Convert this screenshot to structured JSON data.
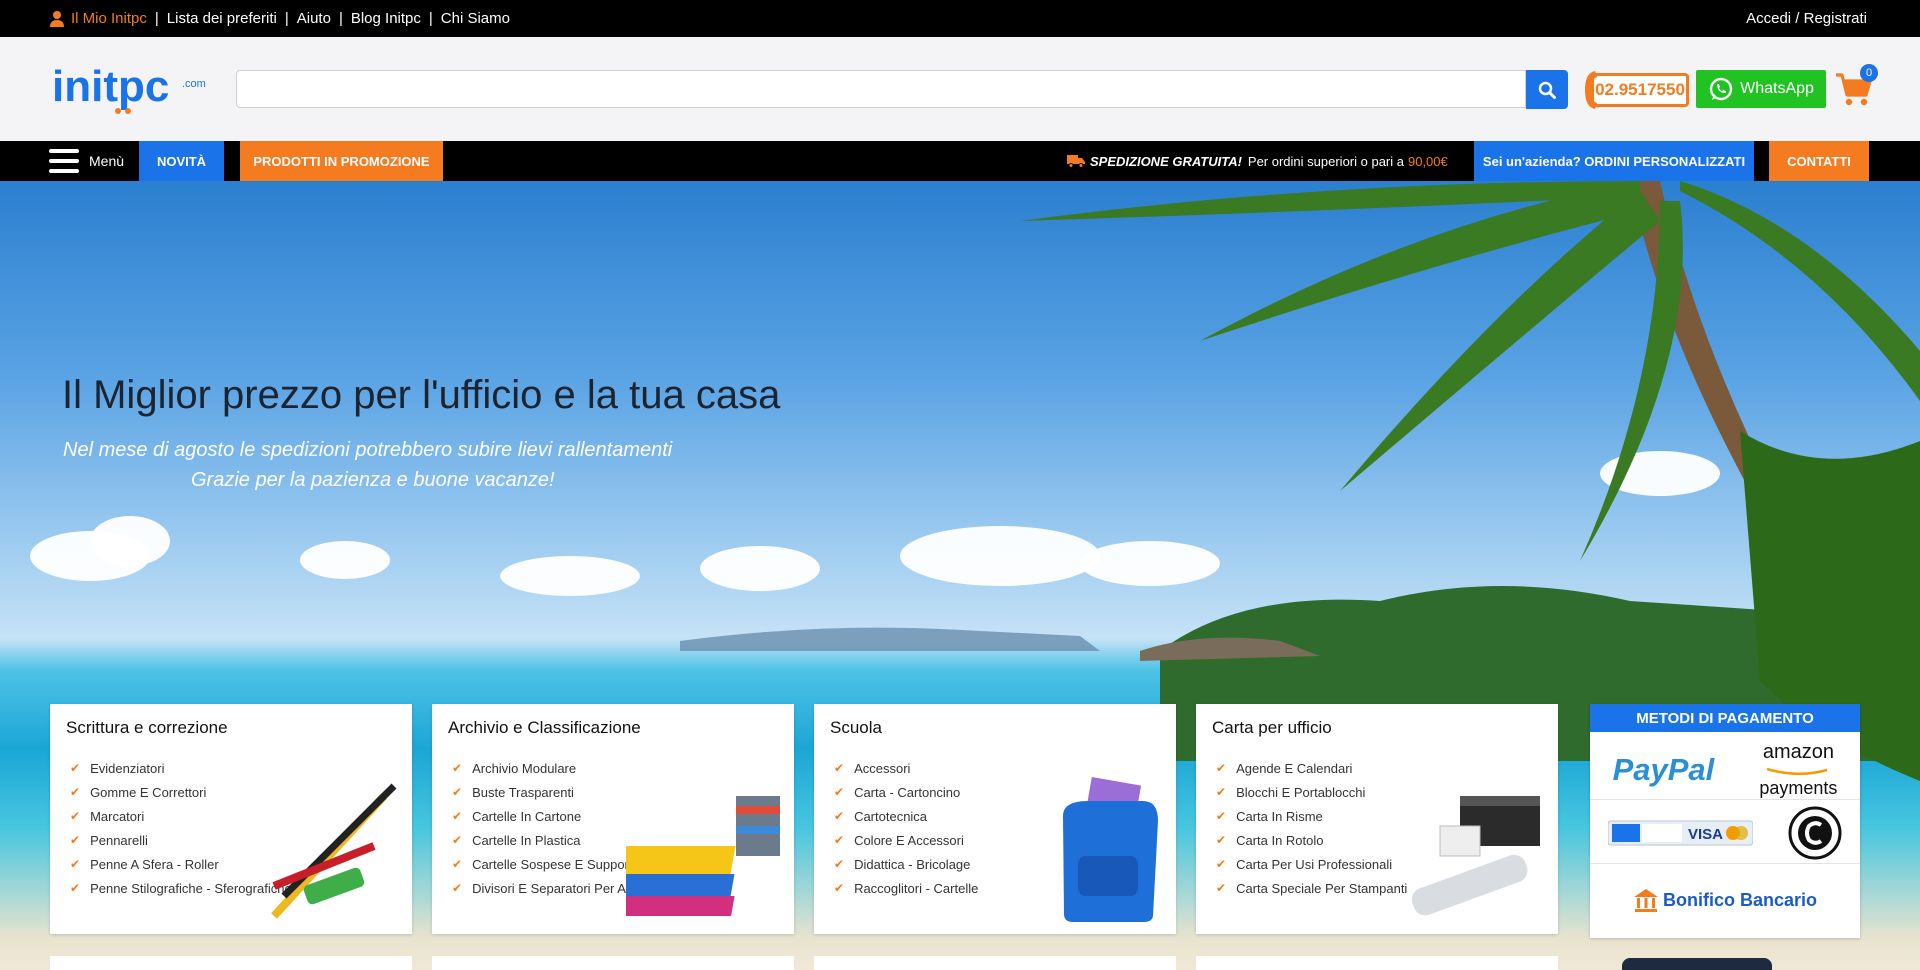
{
  "topbar": {
    "links": [
      "Il Mio Initpc",
      "Lista dei preferiti",
      "Aiuto",
      "Blog Initpc",
      "Chi Siamo"
    ],
    "auth": "Accedi / Registrati"
  },
  "header": {
    "logo_text": "initpc",
    "logo_suffix": ".com",
    "search_placeholder": "",
    "phone": "02.9517550",
    "whatsapp": "WhatsApp",
    "cart_count": "0"
  },
  "nav": {
    "menu": "Menù",
    "novita": "NOVITÀ",
    "promo": "PRODOTTI IN PROMOZIONE",
    "shipping_bold": "SPEDIZIONE GRATUITA!",
    "shipping_text": "Per ordini superiori o pari a",
    "shipping_amount": "90,00€",
    "azienda": "Sei un'azienda? ORDINI PERSONALIZZATI",
    "contatti": "CONTATTI"
  },
  "hero": {
    "title": "Il Miglior prezzo per l'ufficio e la tua casa",
    "subtitle1": "Nel mese di agosto le spedizioni potrebbero subire lievi rallentamenti",
    "subtitle2": "Grazie per la pazienza e buone vacanze!"
  },
  "categories": [
    {
      "title": "Scrittura e correzione",
      "items": [
        "Evidenziatori",
        "Gomme E Correttori",
        "Marcatori",
        "Pennarelli",
        "Penne A Sfera - Roller",
        "Penne Stilografiche - Sferografiche"
      ]
    },
    {
      "title": "Archivio e Classificazione",
      "items": [
        "Archivio Modulare",
        "Buste Trasparenti",
        "Cartelle In Cartone",
        "Cartelle In Plastica",
        "Cartelle Sospese E Supporti",
        "Divisori E Separatori Per Archivio"
      ]
    },
    {
      "title": "Scuola",
      "items": [
        "Accessori",
        "Carta - Cartoncino",
        "Cartotecnica",
        "Colore E Accessori",
        "Didattica - Bricolage",
        "Raccoglitori - Cartelle"
      ]
    },
    {
      "title": "Carta per ufficio",
      "items": [
        "Agende E Calendari",
        "Blocchi E Portablocchi",
        "Carta In Risme",
        "Carta In Rotolo",
        "Carta Per Usi Professionali",
        "Carta Speciale Per Stampanti"
      ]
    }
  ],
  "payments": {
    "title": "METODI DI PAGAMENTO",
    "paypal_a": "Pay",
    "paypal_b": "Pal",
    "amazon_a": "amazon",
    "amazon_b": "payments",
    "visa": "VISA",
    "bonifico": "Bonifico Bancario"
  },
  "colors": {
    "accent_orange": "#f47b20",
    "accent_blue": "#1a73e8",
    "whatsapp_green": "#21c323"
  }
}
